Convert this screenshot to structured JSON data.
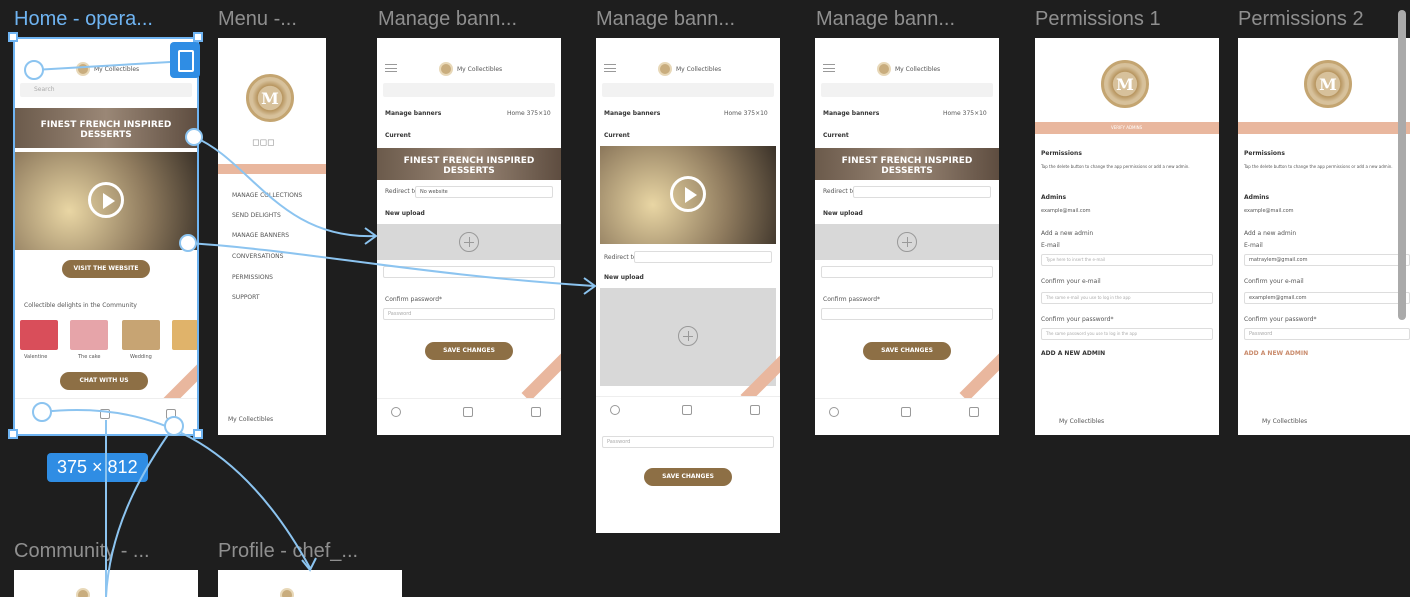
{
  "frames": {
    "home": "Home - opera...",
    "menu": "Menu -...",
    "manage1": "Manage bann...",
    "manage2": "Manage bann...",
    "manage3": "Manage bann...",
    "perm1": "Permissions 1",
    "perm2": "Permissions 2",
    "community": "Community - ...",
    "profile": "Profile - chef_..."
  },
  "selection": {
    "size": "375 × 812"
  },
  "app": {
    "brand": "My Collectibles",
    "search": "Search",
    "banner": "FINEST FRENCH INSPIRED DESSERTS",
    "visit": "VISIT THE WEBSITE",
    "community_title": "Collectible delights in the Community",
    "thumbs": [
      "Valentine",
      "The cake",
      "Wedding"
    ],
    "chat": "CHAT WITH US",
    "corner": "Community",
    "verify": "VERIFY ADMINS"
  },
  "menu": {
    "items": [
      "MANAGE COLLECTIONS",
      "SEND DELIGHTS",
      "MANAGE BANNERS",
      "CONVERSATIONS",
      "PERMISSIONS",
      "SUPPORT"
    ]
  },
  "manage": {
    "title": "Manage banners",
    "dropdown": "Home 375×10",
    "current": "Current",
    "redirect": "Redirect to:",
    "redirect_val": "No website",
    "new_upload": "New upload",
    "confirm_pw": "Confirm password*",
    "pw_placeholder": "Password",
    "save": "SAVE CHANGES",
    "nav": [
      "Profile",
      "Home",
      "Community"
    ]
  },
  "perm": {
    "title": "Permissions",
    "desc": "Tap the delete button to change the app permissions or add a new admin.",
    "admins": "Admins",
    "admin_email": "example@mail.com",
    "add_admin": "Add a new admin",
    "email_label": "E-mail",
    "email_ph": "Type here to insert the e-mail",
    "email_val": "matraylem@gmail.com",
    "confirm_email": "Confirm your e-mail",
    "confirm_email_ph": "The same e-mail you use to log in the app",
    "confirm_email_val": "examplem@gmail.com",
    "confirm_pw": "Confirm your password*",
    "confirm_pw_ph": "The same password you use to log in the app",
    "pw_val": "Password",
    "add_btn": "ADD A NEW ADMIN"
  }
}
